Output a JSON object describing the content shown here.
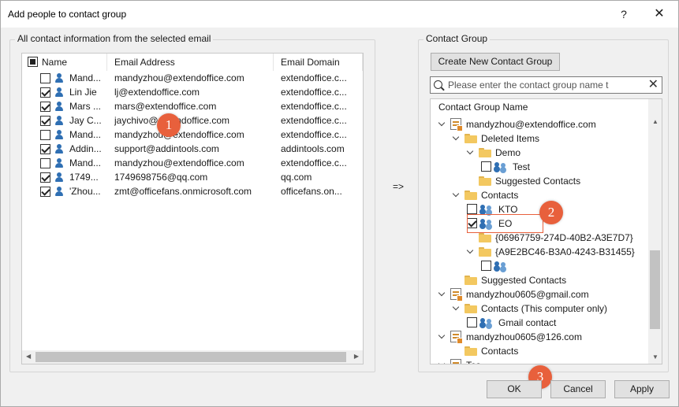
{
  "window": {
    "title": "Add people to contact group",
    "help_glyph": "?",
    "close_glyph": "✕"
  },
  "left_panel": {
    "group_title": "All contact information from the selected email",
    "columns": [
      "Name",
      "Email Address",
      "Email Domain"
    ],
    "header_checkbox_state": "partial",
    "rows": [
      {
        "checked": false,
        "name": "Mand...",
        "email": "mandyzhou@extendoffice.com",
        "domain": "extendoffice.c..."
      },
      {
        "checked": true,
        "name": "Lin Jie",
        "email": "lj@extendoffice.com",
        "domain": "extendoffice.c..."
      },
      {
        "checked": true,
        "name": "Mars ...",
        "email": "mars@extendoffice.com",
        "domain": "extendoffice.c..."
      },
      {
        "checked": true,
        "name": "Jay C...",
        "email": "jaychivo@extendoffice.com",
        "domain": "extendoffice.c..."
      },
      {
        "checked": false,
        "name": "Mand...",
        "email": "mandyzhou@extendoffice.com",
        "domain": "extendoffice.c..."
      },
      {
        "checked": true,
        "name": "Addin...",
        "email": "support@addintools.com",
        "domain": "addintools.com"
      },
      {
        "checked": false,
        "name": "Mand...",
        "email": "mandyzhou@extendoffice.com",
        "domain": "extendoffice.c..."
      },
      {
        "checked": true,
        "name": "1749...",
        "email": "1749698756@qq.com",
        "domain": "qq.com"
      },
      {
        "checked": true,
        "name": "'Zhou...",
        "email": "zmt@officefans.onmicrosoft.com",
        "domain": "officefans.on..."
      }
    ]
  },
  "arrow_label": "=>",
  "right_panel": {
    "group_title": "Contact Group",
    "create_button": "Create New Contact Group",
    "search": {
      "placeholder": "Please enter the contact group name t",
      "value": ""
    },
    "tree_header": "Contact Group Name",
    "tree": [
      {
        "level": 0,
        "kind": "store",
        "expander": true,
        "label": "mandyzhou@extendoffice.com"
      },
      {
        "level": 1,
        "kind": "folder",
        "expander": true,
        "label": "Deleted Items"
      },
      {
        "level": 2,
        "kind": "folder",
        "expander": true,
        "label": "Demo"
      },
      {
        "level": 3,
        "kind": "group",
        "checkbox": false,
        "label": "Test"
      },
      {
        "level": 2,
        "kind": "folder",
        "expander": false,
        "label": "Suggested Contacts"
      },
      {
        "level": 1,
        "kind": "folder",
        "expander": true,
        "label": "Contacts"
      },
      {
        "level": 2,
        "kind": "group",
        "checkbox": false,
        "label": "KTO"
      },
      {
        "level": 2,
        "kind": "group",
        "checkbox": true,
        "label": "EO"
      },
      {
        "level": 2,
        "kind": "folder",
        "expander": false,
        "label": "{06967759-274D-40B2-A3E7D7}"
      },
      {
        "level": 2,
        "kind": "folder",
        "expander": true,
        "label": "{A9E2BC46-B3A0-4243-B31455}"
      },
      {
        "level": 3,
        "kind": "group",
        "checkbox": false,
        "label": ""
      },
      {
        "level": 1,
        "kind": "folder",
        "expander": false,
        "label": "Suggested Contacts"
      },
      {
        "level": 0,
        "kind": "store",
        "expander": true,
        "label": "mandyzhou0605@gmail.com"
      },
      {
        "level": 1,
        "kind": "folder",
        "expander": true,
        "label": "Contacts (This computer only)"
      },
      {
        "level": 2,
        "kind": "group",
        "checkbox": false,
        "label": "Gmail contact"
      },
      {
        "level": 0,
        "kind": "store",
        "expander": true,
        "label": "mandyzhou0605@126.com"
      },
      {
        "level": 1,
        "kind": "folder",
        "expander": false,
        "label": "Contacts"
      },
      {
        "level": 0,
        "kind": "store",
        "expander": true,
        "label": "Tes..."
      }
    ]
  },
  "badges": [
    "1",
    "2",
    "3"
  ],
  "buttons": {
    "ok": "OK",
    "cancel": "Cancel",
    "apply": "Apply"
  },
  "colors": {
    "badge": "#e8603c",
    "highlight": "#e8603c",
    "person_icon": "#2f6fb3",
    "folder": "#f3c860"
  }
}
